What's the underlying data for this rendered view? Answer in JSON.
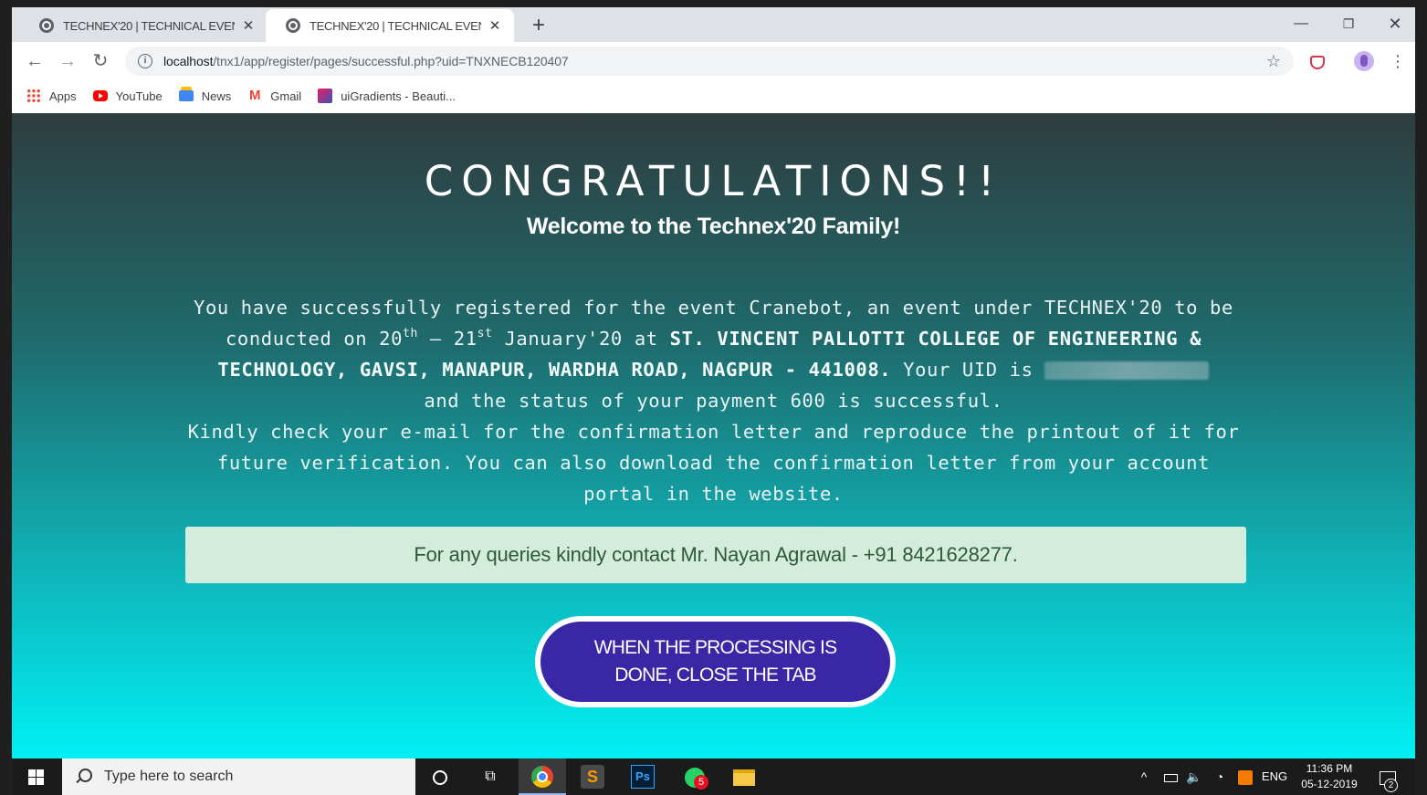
{
  "browser": {
    "tabs": [
      {
        "title": "TECHNEX'20 | TECHNICAL EVENT",
        "active": false
      },
      {
        "title": "TECHNEX'20 | TECHNICAL EVENT",
        "active": true
      }
    ],
    "new_tab_label": "+",
    "url_host": "localhost",
    "url_path": "/tnx1/app/register/pages/successful.php?uid=TNXNECB120407",
    "bookmarks": [
      {
        "label": "Apps",
        "icon": "apps-icon"
      },
      {
        "label": "YouTube",
        "icon": "youtube-icon"
      },
      {
        "label": "News",
        "icon": "news-icon"
      },
      {
        "label": "Gmail",
        "icon": "gmail-icon"
      },
      {
        "label": "uiGradients - Beauti...",
        "icon": "uigradients-icon"
      }
    ]
  },
  "page": {
    "heading": "CONGRATULATIONS!!",
    "subheading": "Welcome to the Technex'20 Family!",
    "message": {
      "p1_before_event": "You have successfully registered for the event ",
      "event_name": "Cranebot",
      "p1_after_event": ", an event under TECHNEX'20 to be conducted on 20",
      "sup1": "th",
      "dash": " – 21",
      "sup2": "st",
      "p1_month": " January'20 at ",
      "venue": "ST. VINCENT PALLOTTI COLLEGE OF ENGINEERING & TECHNOLOGY, GAVSI, MANAPUR, WARDHA ROAD, NAGPUR - 441008.",
      "uid_text": " Your UID is ",
      "payment_text": " and the status of your payment 600 is successful.",
      "p2": "Kindly check your e-mail for the confirmation letter and reproduce the printout of it for future verification. You can also download the confirmation letter from your account portal in the website."
    },
    "contact": "For any queries kindly contact Mr. Nayan Agrawal - +91 8421628277.",
    "close_button": "WHEN THE PROCESSING IS DONE, CLOSE THE TAB"
  },
  "taskbar": {
    "search_placeholder": "Type here to search",
    "whatsapp_badge": "5",
    "language": "ENG",
    "time": "11:36 PM",
    "date": "05-12-2019",
    "notifications_badge": "2"
  },
  "colors": {
    "page_gradient_top": "#2f3d3f",
    "page_gradient_bottom": "#00f0f5",
    "button_bg": "#3a27a6",
    "contact_bg": "#d4ecdc",
    "contact_text": "#2d5a3a"
  }
}
